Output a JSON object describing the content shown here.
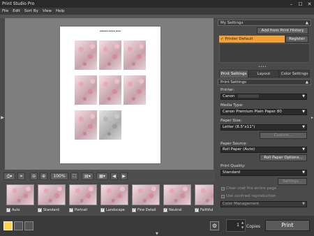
{
  "window": {
    "title": "Print Studio Pro",
    "min": "–",
    "max": "☐",
    "close": "✕"
  },
  "menu": [
    "File",
    "Edit",
    "Sort By",
    "View",
    "Help"
  ],
  "toolbar": {
    "zoom_value": "100%"
  },
  "presets": [
    {
      "label": "Auto",
      "checked": true
    },
    {
      "label": "Standard",
      "checked": true
    },
    {
      "label": "Portrait",
      "checked": true
    },
    {
      "label": "Landscape",
      "checked": true
    },
    {
      "label": "Fine Detail",
      "checked": true
    },
    {
      "label": "Neutral",
      "checked": true
    },
    {
      "label": "Faithful",
      "checked": true
    }
  ],
  "my_settings": {
    "title": "My Settings",
    "add_history": "Add from Print History",
    "selected": "Printer Default",
    "register": "Register"
  },
  "tabs": [
    "Print Settings",
    "Layout",
    "Color Settings"
  ],
  "print_settings": {
    "section": "Print Settings",
    "printer_label": "Printer:",
    "printer_value": "Canon",
    "media_label": "Media Type:",
    "media_value": "Canon Premium Plain Paper 80",
    "size_label": "Paper Size:",
    "size_value": "Letter (8.5\"x11\")",
    "custom": "Custom...",
    "source_label": "Paper Source:",
    "source_value": "Roll Paper (Auto)",
    "roll_options": "Roll Paper Options...",
    "quality_label": "Print Quality:",
    "quality_value": "Standard",
    "settings": "Settings...",
    "coat": "Clear coat the entire page",
    "color_repro": "Use contrast reproduction",
    "color_mgmt": "Color Management"
  },
  "bottom": {
    "copies_value": "1",
    "copies_label": "Copies",
    "print": "Print"
  },
  "colors": {
    "accent": "#f5a034",
    "print_button": "#5a5a5a"
  }
}
